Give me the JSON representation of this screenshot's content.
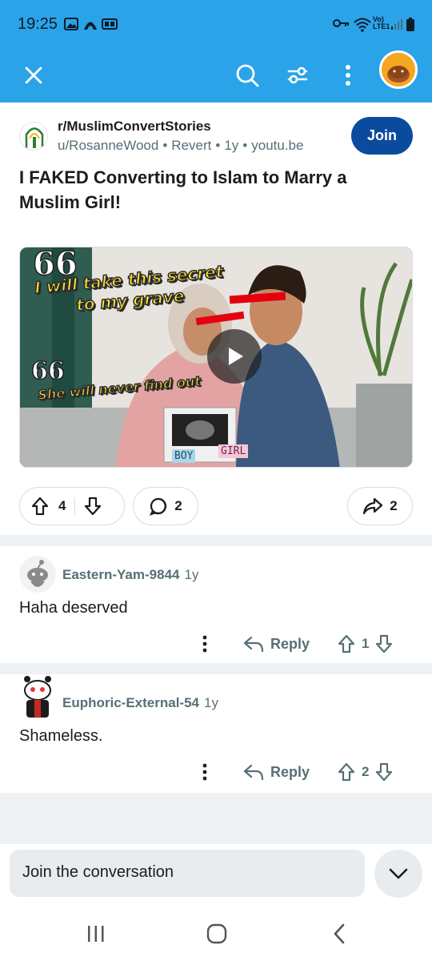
{
  "status": {
    "time": "19:25",
    "network": "Vo) LTE1"
  },
  "toolbar": {
    "close_icon": "close-icon",
    "search_icon": "search-icon",
    "filter_icon": "filter-icon",
    "more_icon": "more-icon"
  },
  "post": {
    "subreddit": "r/MuslimConvertStories",
    "author": "u/RosanneWood",
    "flair": "Revert",
    "age": "1y",
    "domain": "youtu.be",
    "join_label": "Join",
    "title": "I FAKED Converting to Islam to Marry a Muslim Girl!",
    "thumbnail": {
      "caption_1a": "I will take this secret",
      "caption_1b": "to my grave",
      "caption_2": "She will never find out",
      "quote_mark": "66",
      "tag_boy": "BOY",
      "tag_girl": "GIRL"
    },
    "votes": "4",
    "comments": "2",
    "shares": "2"
  },
  "comments": [
    {
      "user": "Eastern-Yam-9844",
      "age": "1y",
      "body": "Haha deserved",
      "reply_label": "Reply",
      "votes": "1"
    },
    {
      "user": "Euphoric-External-54",
      "age": "1y",
      "body": "Shameless.",
      "reply_label": "Reply",
      "votes": "2"
    }
  ],
  "composer": {
    "placeholder": "Join the conversation"
  },
  "colors": {
    "header": "#2aa3e8",
    "join": "#0b4b9e",
    "muted": "#576f76"
  }
}
